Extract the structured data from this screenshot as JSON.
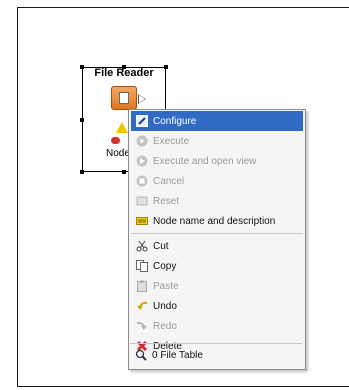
{
  "node": {
    "title": "File Reader",
    "label": "Node"
  },
  "context_menu": {
    "items": [
      {
        "label": "Configure",
        "icon": "configure-icon",
        "selected": true
      },
      {
        "label": "Execute",
        "icon": "execute-icon",
        "disabled": true
      },
      {
        "label": "Execute and open view",
        "icon": "execute-open-view-icon",
        "disabled": true
      },
      {
        "label": "Cancel",
        "icon": "cancel-icon",
        "disabled": true
      },
      {
        "label": "Reset",
        "icon": "reset-icon",
        "disabled": true
      },
      {
        "label": "Node name and description",
        "icon": "node-description-icon"
      },
      {
        "label": "Cut",
        "icon": "cut-icon"
      },
      {
        "label": "Copy",
        "icon": "copy-icon"
      },
      {
        "label": "Paste",
        "icon": "paste-icon",
        "disabled": true
      },
      {
        "label": "Undo",
        "icon": "undo-icon"
      },
      {
        "label": "Redo",
        "icon": "redo-icon",
        "disabled": true
      },
      {
        "label": "Delete",
        "icon": "delete-icon"
      },
      {
        "label": "0 File Table",
        "icon": "magnifier-icon"
      }
    ]
  },
  "colors": {
    "selection": "#316ac5",
    "node_orange": "#e07422",
    "warning": "#f2c200",
    "delete_red": "#d42a2a"
  }
}
